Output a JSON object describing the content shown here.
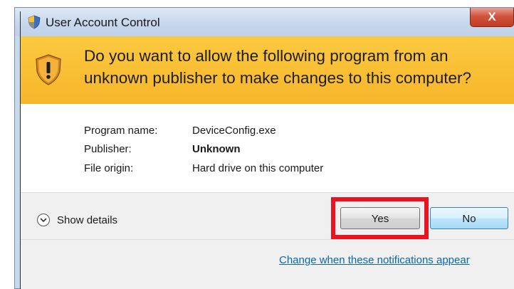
{
  "window": {
    "title": "User Account Control",
    "close_label": "X",
    "icon": "uac-shield-icon"
  },
  "banner": {
    "question": "Do you want to allow the following program from an unknown publisher to make changes to this computer?",
    "icon": "warning-shield-icon",
    "color": "#f9c035"
  },
  "details": {
    "program_label": "Program name:",
    "program_value": "DeviceConfig.exe",
    "publisher_label": "Publisher:",
    "publisher_value": "Unknown",
    "origin_label": "File origin:",
    "origin_value": "Hard drive on this computer"
  },
  "footer": {
    "show_details_label": "Show details",
    "yes_label": "Yes",
    "no_label": "No",
    "notifications_link": "Change when these notifications appear"
  },
  "highlight_color": "#e8141f"
}
